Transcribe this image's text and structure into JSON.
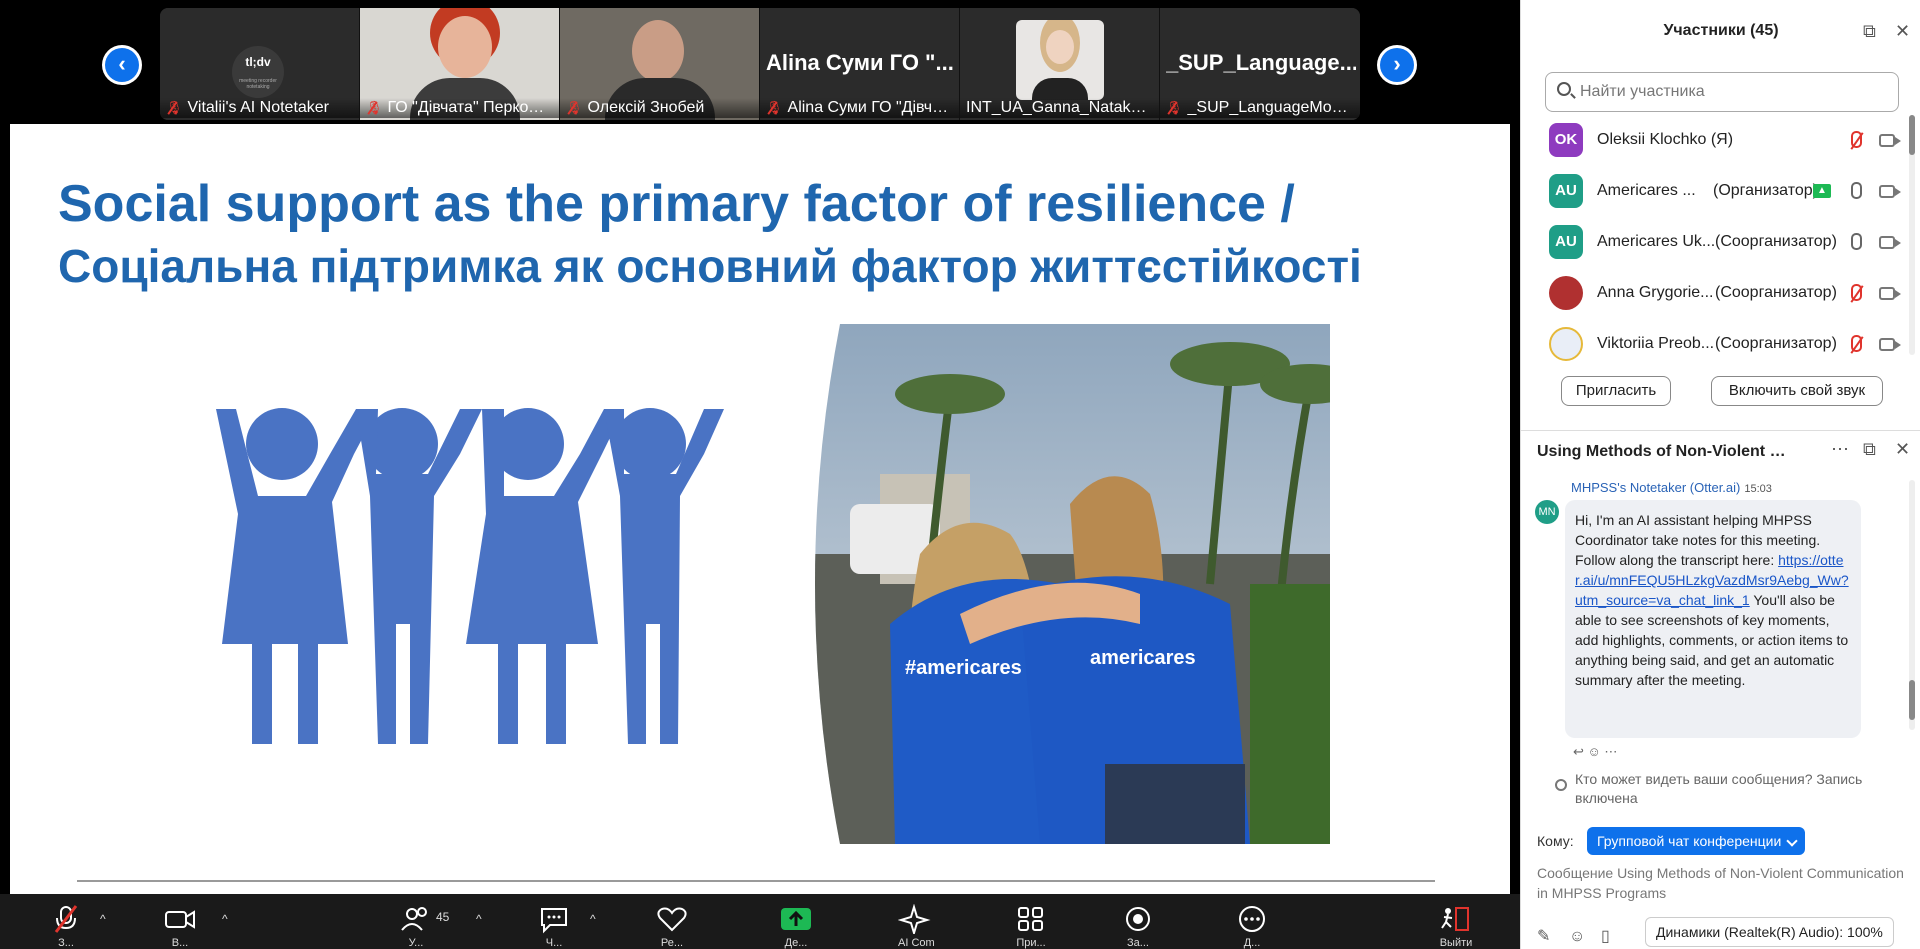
{
  "participants_strip": {
    "tiles": [
      {
        "name": "Vitalii's AI Notetaker",
        "logo_text": "tl;dv",
        "logo_subtext": "meeting recorder notetaking"
      },
      {
        "name": "ГО \"Дівчата\" Перкола..."
      },
      {
        "name": "Олексій Знобей"
      },
      {
        "name": "Alina Суми ГО \"Дівчат...",
        "big_name": "Alina Суми ГО \"..."
      },
      {
        "name": "INT_UA_Ganna_Natakallam"
      },
      {
        "name": "_SUP_LanguageMonit...",
        "big_name": "_SUP_Language..."
      }
    ],
    "prev_icon": "chevron-left-icon",
    "next_icon": "chevron-right-icon"
  },
  "slide": {
    "title_en": "Social support as the primary factor of resilience /",
    "title_ua": "Соціальна підтримка як основний фактор життєстійкості",
    "shirt_text_1": "#americares",
    "shirt_text_2": "americares",
    "figure_color": "#4a73c4",
    "title_color": "#1f66ae"
  },
  "toolbar": {
    "mute_label": "З...",
    "video_label": "В...",
    "participants_label": "У...",
    "participants_count": "45",
    "chat_label": "Ч...",
    "reactions_label": "Ре...",
    "share_label": "Де...",
    "ai_label": "AI Companion",
    "apps_label": "При...",
    "record_label": "За...",
    "more_label": "Д...",
    "leave_label": "Выйти"
  },
  "participants_panel": {
    "title": "Участники (45)",
    "search_placeholder": "Найти участника",
    "rows": [
      {
        "initials": "OK",
        "color": "#8e3bbf",
        "name": "Oleksii Klochko (Я)",
        "role": "",
        "mic": "off"
      },
      {
        "initials": "AU",
        "color": "#1f9e87",
        "name": "Americares ...",
        "role": "(Организатор)",
        "mic": "on",
        "sharing": true
      },
      {
        "initials": "AU",
        "color": "#1f9e87",
        "name": "Americares Uk...",
        "role": "(Соорганизатор)",
        "mic": "on"
      },
      {
        "initials": "",
        "color": "#b03030",
        "name": "Anna Grygorie...",
        "role": "(Соорганизатор)",
        "mic": "off"
      },
      {
        "initials": "",
        "color": "#e9eef7",
        "name": "Viktoriia Preob...",
        "role": "(Соорганизатор)",
        "mic": "off"
      }
    ],
    "invite_button": "Пригласить",
    "unmute_button": "Включить свой звук"
  },
  "chat_panel": {
    "title": "Using Methods of Non-Violent Co...",
    "sender": "MHPSS's Notetaker (Otter.ai)",
    "time": "15:03",
    "avatar": "MN",
    "message_intro": "Hi, I'm an AI assistant helping MHPSS Coordinator take notes for this meeting. Follow along the transcript here: ",
    "message_link": "https://otter.ai/u/mnFEQU5HLzkgVazdMsr9Aebg_Ww?utm_source=va_chat_link_1",
    "message_rest": " You'll also be able to see screenshots of key moments, add highlights, comments, or action items to anything being said, and get an automatic summary after the meeting.",
    "visibility_note": "Кто может видеть ваши сообщения? Запись включена",
    "to_label": "Кому:",
    "to_value": "Групповой чат конференции",
    "input_placeholder": "Сообщение Using Methods of Non-Violent Communication in MHPSS Programs"
  },
  "audio_tooltip": "Динамики (Realtek(R) Audio): 100%"
}
